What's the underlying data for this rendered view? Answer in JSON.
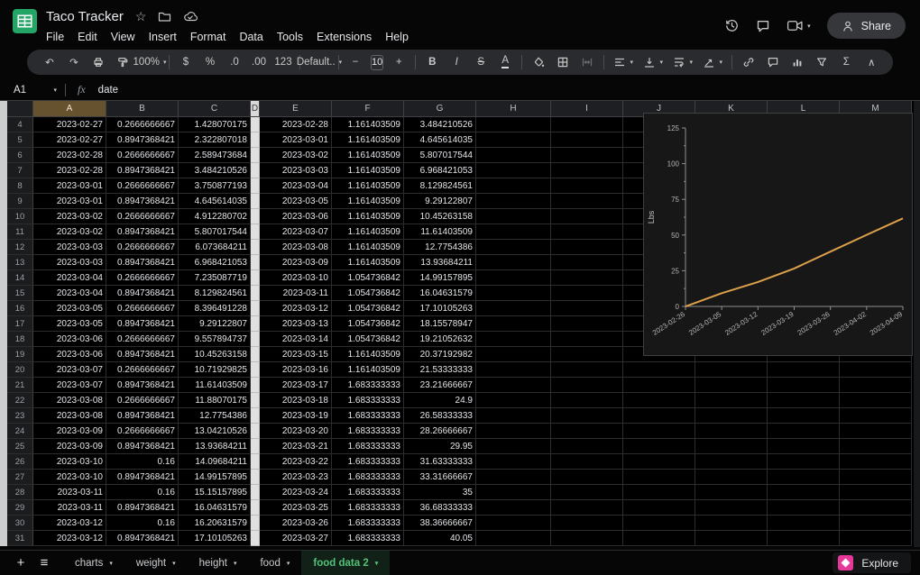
{
  "titlebar": {
    "title": "Taco Tracker",
    "menus": [
      "File",
      "Edit",
      "View",
      "Insert",
      "Format",
      "Data",
      "Tools",
      "Extensions",
      "Help"
    ],
    "share_label": "Share"
  },
  "toolbar": {
    "zoom": "100%",
    "currency": "$",
    "percent": "%",
    "decrease_decimal": ".0",
    "increase_decimal": ".00",
    "more_formats": "123",
    "font": "Default..",
    "decrease_font": "−",
    "font_size": "10",
    "increase_font": "+",
    "bold": "B",
    "italic": "I",
    "strikethrough": "S",
    "text_color": "A",
    "functions": "Σ"
  },
  "formula_bar": {
    "cell_ref": "A1",
    "fx_label": "fx",
    "value": "date"
  },
  "grid": {
    "columns": [
      "A",
      "B",
      "C",
      "D",
      "E",
      "F",
      "G",
      "H",
      "I",
      "J",
      "K",
      "L",
      "M"
    ],
    "rows": [
      [
        4,
        "2023-02-27",
        "0.2666666667",
        "1.428070175",
        "2023-02-28",
        "1.161403509",
        "3.484210526"
      ],
      [
        5,
        "2023-02-27",
        "0.8947368421",
        "2.322807018",
        "2023-03-01",
        "1.161403509",
        "4.645614035"
      ],
      [
        6,
        "2023-02-28",
        "0.2666666667",
        "2.589473684",
        "2023-03-02",
        "1.161403509",
        "5.807017544"
      ],
      [
        7,
        "2023-02-28",
        "0.8947368421",
        "3.484210526",
        "2023-03-03",
        "1.161403509",
        "6.968421053"
      ],
      [
        8,
        "2023-03-01",
        "0.2666666667",
        "3.750877193",
        "2023-03-04",
        "1.161403509",
        "8.129824561"
      ],
      [
        9,
        "2023-03-01",
        "0.8947368421",
        "4.645614035",
        "2023-03-05",
        "1.161403509",
        "9.29122807"
      ],
      [
        10,
        "2023-03-02",
        "0.2666666667",
        "4.912280702",
        "2023-03-06",
        "1.161403509",
        "10.45263158"
      ],
      [
        11,
        "2023-03-02",
        "0.8947368421",
        "5.807017544",
        "2023-03-07",
        "1.161403509",
        "11.61403509"
      ],
      [
        12,
        "2023-03-03",
        "0.2666666667",
        "6.073684211",
        "2023-03-08",
        "1.161403509",
        "12.7754386"
      ],
      [
        13,
        "2023-03-03",
        "0.8947368421",
        "6.968421053",
        "2023-03-09",
        "1.161403509",
        "13.93684211"
      ],
      [
        14,
        "2023-03-04",
        "0.2666666667",
        "7.235087719",
        "2023-03-10",
        "1.054736842",
        "14.99157895"
      ],
      [
        15,
        "2023-03-04",
        "0.8947368421",
        "8.129824561",
        "2023-03-11",
        "1.054736842",
        "16.04631579"
      ],
      [
        16,
        "2023-03-05",
        "0.2666666667",
        "8.396491228",
        "2023-03-12",
        "1.054736842",
        "17.10105263"
      ],
      [
        17,
        "2023-03-05",
        "0.8947368421",
        "9.29122807",
        "2023-03-13",
        "1.054736842",
        "18.15578947"
      ],
      [
        18,
        "2023-03-06",
        "0.2666666667",
        "9.557894737",
        "2023-03-14",
        "1.054736842",
        "19.21052632"
      ],
      [
        19,
        "2023-03-06",
        "0.8947368421",
        "10.45263158",
        "2023-03-15",
        "1.161403509",
        "20.37192982"
      ],
      [
        20,
        "2023-03-07",
        "0.2666666667",
        "10.71929825",
        "2023-03-16",
        "1.161403509",
        "21.53333333"
      ],
      [
        21,
        "2023-03-07",
        "0.8947368421",
        "11.61403509",
        "2023-03-17",
        "1.683333333",
        "23.21666667"
      ],
      [
        22,
        "2023-03-08",
        "0.2666666667",
        "11.88070175",
        "2023-03-18",
        "1.683333333",
        "24.9"
      ],
      [
        23,
        "2023-03-08",
        "0.8947368421",
        "12.7754386",
        "2023-03-19",
        "1.683333333",
        "26.58333333"
      ],
      [
        24,
        "2023-03-09",
        "0.2666666667",
        "13.04210526",
        "2023-03-20",
        "1.683333333",
        "28.26666667"
      ],
      [
        25,
        "2023-03-09",
        "0.8947368421",
        "13.93684211",
        "2023-03-21",
        "1.683333333",
        "29.95"
      ],
      [
        26,
        "2023-03-10",
        "0.16",
        "14.09684211",
        "2023-03-22",
        "1.683333333",
        "31.63333333"
      ],
      [
        27,
        "2023-03-10",
        "0.8947368421",
        "14.99157895",
        "2023-03-23",
        "1.683333333",
        "33.31666667"
      ],
      [
        28,
        "2023-03-11",
        "0.16",
        "15.15157895",
        "2023-03-24",
        "1.683333333",
        "35"
      ],
      [
        29,
        "2023-03-11",
        "0.8947368421",
        "16.04631579",
        "2023-03-25",
        "1.683333333",
        "36.68333333"
      ],
      [
        30,
        "2023-03-12",
        "0.16",
        "16.20631579",
        "2023-03-26",
        "1.683333333",
        "38.36666667"
      ],
      [
        31,
        "2023-03-12",
        "0.8947368421",
        "17.10105263",
        "2023-03-27",
        "1.683333333",
        "40.05"
      ]
    ]
  },
  "chart_data": {
    "type": "line",
    "title": "",
    "xlabel": "",
    "ylabel": "Lbs",
    "ylim": [
      0,
      125
    ],
    "yticks": [
      0,
      25,
      50,
      75,
      100,
      125
    ],
    "xticklabels": [
      "2023-02-26",
      "2023-03-05",
      "2023-03-12",
      "2023-03-19",
      "2023-03-26",
      "2023-04-02",
      "2023-04-09"
    ],
    "grid": false,
    "legend": false,
    "series": [
      {
        "name": "Lbs",
        "color": "#dda04a",
        "x_days": [
          0,
          7,
          14,
          21,
          28,
          35,
          42
        ],
        "values": [
          0,
          9.3,
          17.1,
          26.6,
          38.4,
          50.1,
          61.7
        ]
      }
    ]
  },
  "sheetbar": {
    "tabs": [
      {
        "label": "charts",
        "active": false
      },
      {
        "label": "weight",
        "active": false
      },
      {
        "label": "height",
        "active": false
      },
      {
        "label": "food",
        "active": false
      },
      {
        "label": "food data 2",
        "active": true
      }
    ],
    "explore_label": "Explore"
  },
  "colors": {
    "accent_line": "#dda04a",
    "selected_column_header": "#66522f",
    "active_tab_green": "#53c278",
    "explore_pink": "#e8379b",
    "sheets_green": "#23a566"
  }
}
